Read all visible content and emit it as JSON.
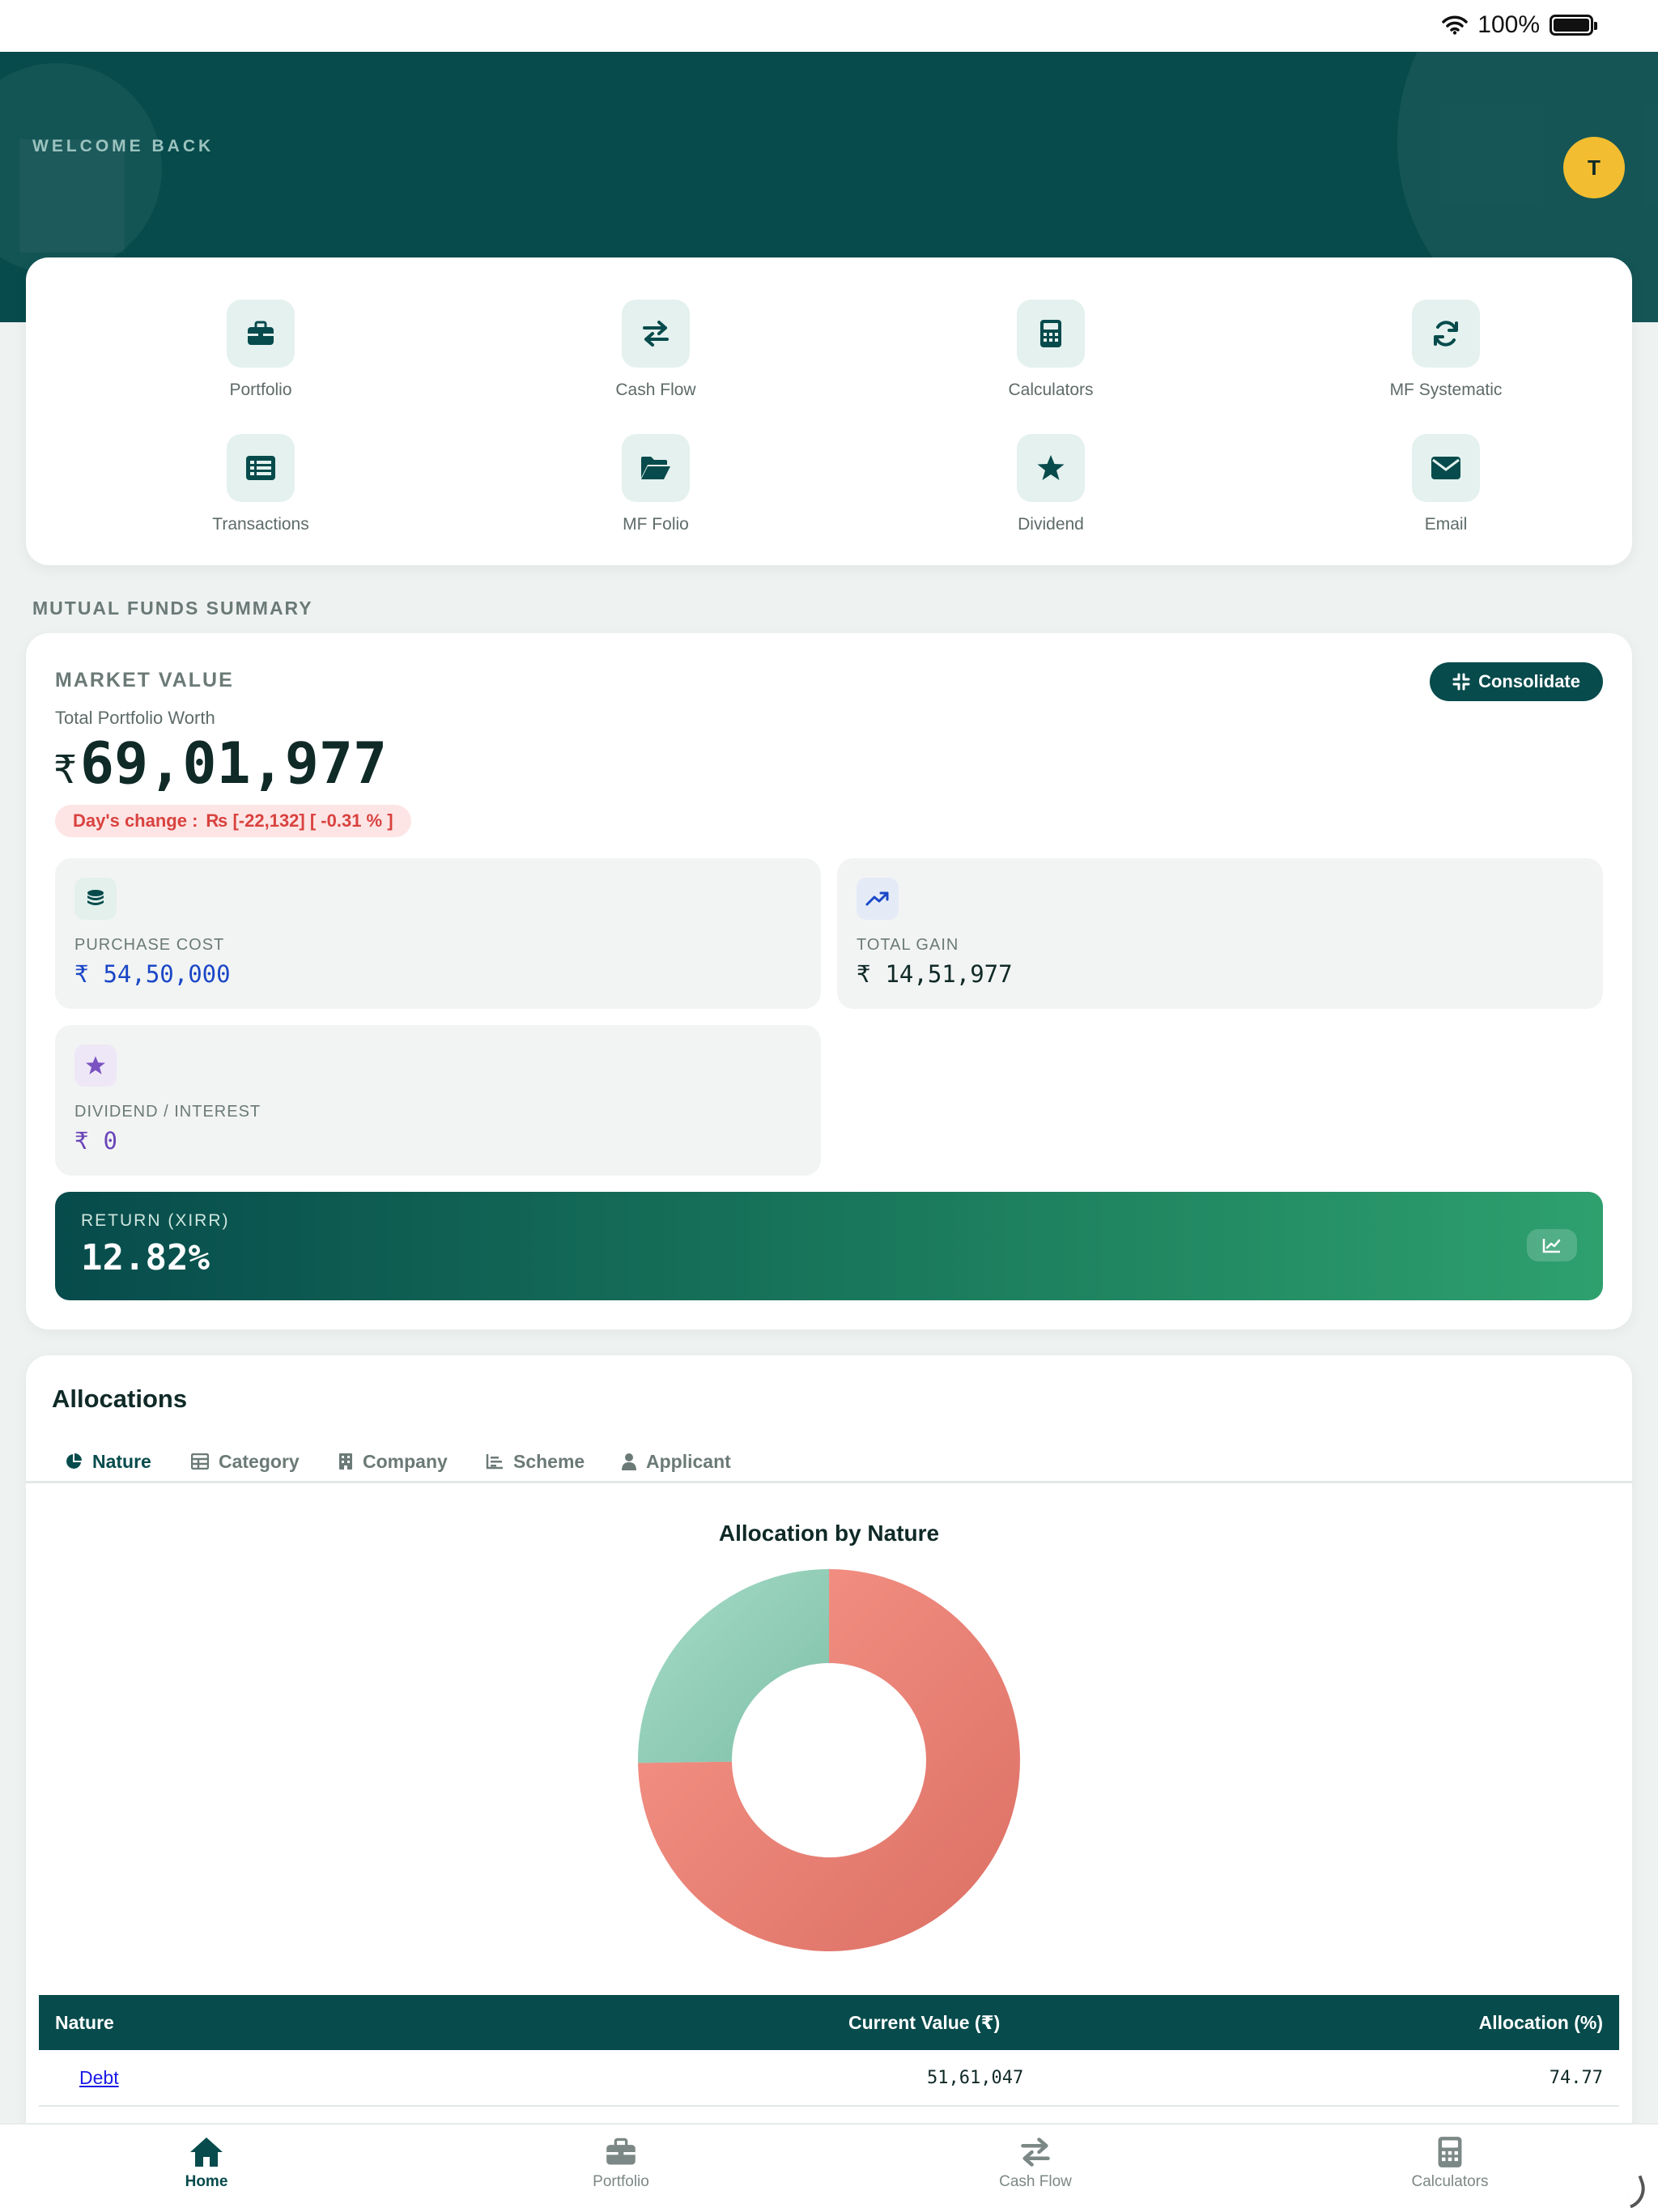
{
  "status_bar": {
    "battery": "100%"
  },
  "header": {
    "welcome": "WELCOME BACK",
    "avatar_initial": "T"
  },
  "quick_actions": [
    {
      "label": "Portfolio",
      "icon": "briefcase-icon"
    },
    {
      "label": "Cash Flow",
      "icon": "swap-arrows-icon"
    },
    {
      "label": "Calculators",
      "icon": "calculator-icon"
    },
    {
      "label": "MF Systematic",
      "icon": "refresh-icon"
    },
    {
      "label": "Transactions",
      "icon": "list-icon"
    },
    {
      "label": "MF Folio",
      "icon": "folder-open-icon"
    },
    {
      "label": "Dividend",
      "icon": "star-icon"
    },
    {
      "label": "Email",
      "icon": "envelope-icon"
    }
  ],
  "summary": {
    "section_title": "MUTUAL FUNDS SUMMARY",
    "market_value_title": "MARKET VALUE",
    "total_label": "Total Portfolio Worth",
    "currency": "₹",
    "total_value": "69,01,977",
    "consolidate_label": "Consolidate",
    "days_change_label": "Day's change :",
    "days_change_value": "₨  [-22,132] [ -0.31 % ]",
    "purchase_cost": {
      "label": "PURCHASE COST",
      "currency": "₹",
      "value": "54,50,000"
    },
    "total_gain": {
      "label": "TOTAL GAIN",
      "currency": "₹",
      "value": "14,51,977"
    },
    "dividend": {
      "label": "DIVIDEND / INTEREST",
      "currency": "₹",
      "value": "0"
    },
    "xirr": {
      "label": "RETURN (XIRR)",
      "value": "12.82%"
    }
  },
  "allocations": {
    "title": "Allocations",
    "tabs": [
      "Nature",
      "Category",
      "Company",
      "Scheme",
      "Applicant"
    ],
    "active_tab": "Nature",
    "chart_title": "Allocation by Nature",
    "table": {
      "headers": [
        "Nature",
        "Current Value (₹)",
        "Allocation (%)"
      ],
      "rows": [
        {
          "nature": "Debt",
          "value": "51,61,047",
          "allocation": "74.77"
        }
      ]
    }
  },
  "chart_data": {
    "type": "pie",
    "title": "Allocation by Nature",
    "categories": [
      "Debt",
      ""
    ],
    "values": [
      74.77,
      25.23
    ],
    "colors": [
      "#e97c70",
      "#8fcbb5"
    ]
  },
  "bottom_nav": [
    {
      "label": "Home",
      "icon": "home-icon",
      "active": true
    },
    {
      "label": "Portfolio",
      "icon": "briefcase-icon",
      "active": false
    },
    {
      "label": "Cash Flow",
      "icon": "swap-arrows-icon",
      "active": false
    },
    {
      "label": "Calculators",
      "icon": "calculator-icon",
      "active": false
    }
  ],
  "colors": {
    "primary": "#074b4c",
    "accent": "#f2bd30",
    "negative": "#d9423f",
    "link": "#1a1ae6"
  }
}
